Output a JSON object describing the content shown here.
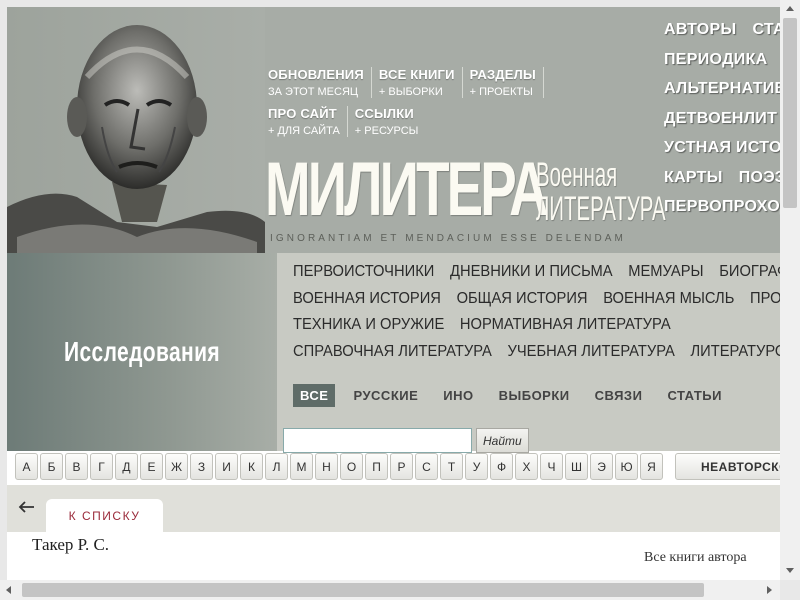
{
  "top_nav": [
    {
      "main": "ОБНОВЛЕНИЯ",
      "sub": "ЗА ЭТОТ МЕСЯЦ"
    },
    {
      "main": "ВСЕ КНИГИ",
      "sub": "+ ВЫБОРКИ"
    },
    {
      "main": "РАЗДЕЛЫ",
      "sub": "+ ПРОЕКТЫ"
    },
    {
      "main": "ПРО САЙТ",
      "sub": "+ ДЛЯ САЙТА"
    },
    {
      "main": "ССЫЛКИ",
      "sub": "+ РЕСУРСЫ"
    }
  ],
  "logo": {
    "main": "МИЛИТЕРА",
    "sub_line1": "Военная",
    "sub_line2": "литература",
    "motto": "IGNORANTIAM ET MENDACIUM ESSE DELENDAM"
  },
  "right_menu": [
    [
      "АВТОРЫ",
      "СТАТЬИ"
    ],
    [
      "ПЕРИОДИКА"
    ],
    [
      "АЛЬТЕРНАТИВНАЯ"
    ],
    [
      "ДЕТВОЕНЛИТ"
    ],
    [
      "УСТНАЯ ИСТОРИЯ"
    ],
    [
      "КАРТЫ",
      "ПОЭЗИЯ"
    ],
    [
      "ПЕРВОПРОХОДЧЕСТВО"
    ]
  ],
  "section_title": "Исследования",
  "categories": [
    [
      "ПЕРВОИСТОЧНИКИ",
      "ДНЕВНИКИ И ПИСЬМА",
      "МЕМУАРЫ",
      "БИОГРАФИИ"
    ],
    [
      "ВОЕННАЯ ИСТОРИЯ",
      "ОБЩАЯ ИСТОРИЯ",
      "ВОЕННАЯ МЫСЛЬ",
      "ПРОЗА"
    ],
    [
      "ТЕХНИКА И ОРУЖИЕ",
      "НОРМАТИВНАЯ ЛИТЕРАТУРА"
    ],
    [
      "СПРАВОЧНАЯ ЛИТЕРАТУРА",
      "УЧЕБНАЯ ЛИТЕРАТУРА",
      "ЛИТЕРАТУРОВЕДЕНИЕ"
    ]
  ],
  "filters": [
    "ВСЕ",
    "РУССКИЕ",
    "ИНО",
    "ВЫБОРКИ",
    "СВЯЗИ",
    "СТАТЬИ"
  ],
  "search": {
    "value": "",
    "button": "Найти"
  },
  "alphabet": [
    "А",
    "Б",
    "В",
    "Г",
    "Д",
    "Е",
    "Ж",
    "З",
    "И",
    "К",
    "Л",
    "М",
    "Н",
    "О",
    "П",
    "Р",
    "С",
    "Т",
    "У",
    "Ф",
    "Х",
    "Ч",
    "Ш",
    "Э",
    "Ю",
    "Я"
  ],
  "alphabet_extra": "НЕАВТОРСКОЕ",
  "tab_label": "К СПИСКУ",
  "author": "Такер Р. С.",
  "all_books": "Все книги автора"
}
